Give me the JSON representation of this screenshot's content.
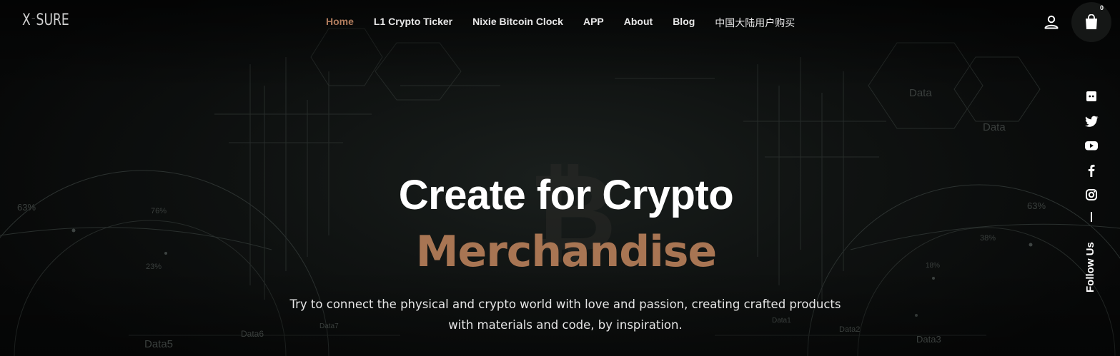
{
  "brand": {
    "logo_left": "X",
    "logo_mid": "—",
    "logo_right": "SURE"
  },
  "nav": {
    "items": [
      {
        "label": "Home",
        "active": true
      },
      {
        "label": "L1 Crypto Ticker"
      },
      {
        "label": "Nixie Bitcoin Clock"
      },
      {
        "label": "APP"
      },
      {
        "label": "About"
      },
      {
        "label": "Blog"
      },
      {
        "label": "中国大陆用户购买"
      }
    ]
  },
  "header": {
    "user_icon": "user-icon",
    "cart_icon": "shopping-bag-icon",
    "cart_count": "0"
  },
  "social": {
    "icons": [
      "discord-icon",
      "twitter-icon",
      "youtube-icon",
      "facebook-icon",
      "instagram-icon"
    ],
    "follow_label": "Follow Us"
  },
  "hero": {
    "title": "Create for Crypto",
    "subtitle": "Merchandise",
    "description": "Try to connect the physical and crypto world with love and passion, creating crafted products with materials and code, by inspiration."
  },
  "background_labels": [
    "Data",
    "Data",
    "63%",
    "76%",
    "23%",
    "63%",
    "38%",
    "18%",
    "Data5",
    "Data6",
    "Data7",
    "Data1",
    "Data2",
    "Data3"
  ],
  "colors": {
    "accent": "#b07c5d",
    "subtitle": "#a87553",
    "background": "#0b0c0c",
    "text": "#ffffff"
  }
}
